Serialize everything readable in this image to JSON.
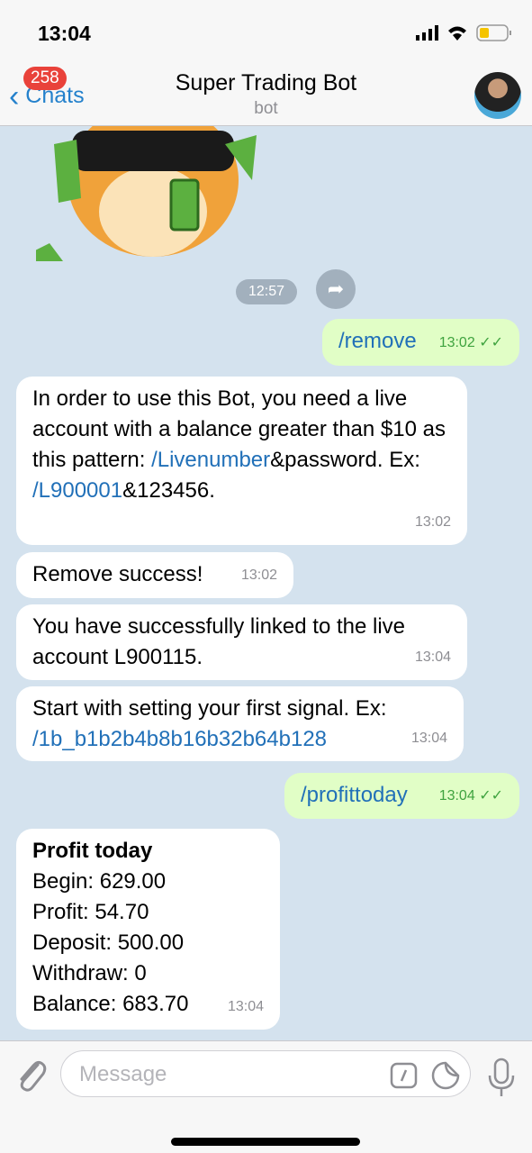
{
  "status_bar": {
    "time": "13:04"
  },
  "header": {
    "back_label": "Chats",
    "unread_badge": "258",
    "title": "Super Trading Bot",
    "subtitle": "bot"
  },
  "sticker": {
    "time": "12:57"
  },
  "messages": [
    {
      "dir": "out",
      "text": "/remove",
      "time": "13:02"
    },
    {
      "dir": "in",
      "parts": [
        "In order to use this Bot, you need a live account with a balance greater than $10 as this pattern: ",
        "/Livenumber",
        "&password. Ex: ",
        "/L900001",
        "&123456."
      ],
      "time": "13:02"
    },
    {
      "dir": "in",
      "text": "Remove success!",
      "time": "13:02"
    },
    {
      "dir": "in",
      "text": "You have successfully linked to the live account L900115.",
      "time": "13:04"
    },
    {
      "dir": "in",
      "parts": [
        "Start with setting your first signal. Ex: ",
        "/1b_b1b2b4b8b16b32b64b128"
      ],
      "time": "13:04"
    },
    {
      "dir": "out",
      "text": "/profittoday",
      "time": "13:04"
    },
    {
      "dir": "in",
      "title": "Profit today",
      "lines": [
        "Begin: 629.00",
        "Profit: 54.70",
        "Deposit: 500.00",
        "Withdraw: 0",
        "Balance: 683.70"
      ],
      "time": "13:04"
    }
  ],
  "input": {
    "placeholder": "Message"
  },
  "colors": {
    "accent": "#2481cc",
    "outgoing": "#e1fec6",
    "badge": "#e9423a"
  }
}
